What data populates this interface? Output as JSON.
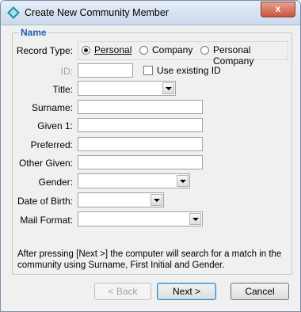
{
  "window": {
    "title": "Create New Community Member",
    "close_glyph": "x"
  },
  "group": {
    "legend": "Name"
  },
  "record_type": {
    "label": "Record Type:",
    "options": [
      {
        "label": "Personal",
        "selected": true
      },
      {
        "label": "Company",
        "selected": false
      },
      {
        "label": "Personal Company",
        "selected": false
      }
    ]
  },
  "id_field": {
    "label": "ID:",
    "value": ""
  },
  "use_existing": {
    "label": "Use existing ID",
    "checked": false
  },
  "fields": {
    "title": {
      "label": "Title:",
      "value": ""
    },
    "surname": {
      "label": "Surname:",
      "value": ""
    },
    "given1": {
      "label": "Given 1:",
      "value": ""
    },
    "preferred": {
      "label": "Preferred:",
      "value": ""
    },
    "other_given": {
      "label": "Other Given:",
      "value": ""
    },
    "gender": {
      "label": "Gender:",
      "value": ""
    },
    "dob": {
      "label": "Date of Birth:",
      "value": ""
    },
    "mail_format": {
      "label": "Mail Format:",
      "value": ""
    }
  },
  "info_text": "After pressing [Next >] the computer will search for a match in the community using Surname, First Initial and Gender.",
  "buttons": {
    "back": "< Back",
    "next": "Next >",
    "cancel": "Cancel"
  },
  "colors": {
    "legend": "#1e5fb4",
    "disabled_text": "#a0a0a0"
  }
}
